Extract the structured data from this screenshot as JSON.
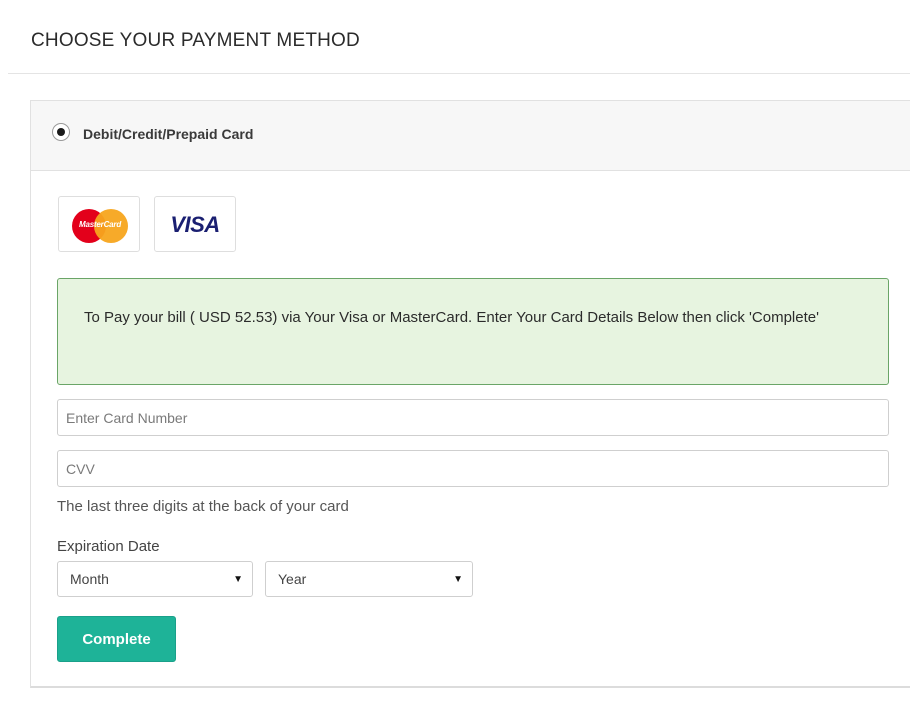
{
  "page": {
    "title": "CHOOSE YOUR PAYMENT METHOD"
  },
  "payment_option": {
    "label": "Debit/Credit/Prepaid Card",
    "selected": true
  },
  "card_brands": [
    {
      "name": "MasterCard",
      "logo_text": "MasterCard",
      "colors": [
        "#e3001b",
        "#f7a51e"
      ]
    },
    {
      "name": "Visa",
      "logo_text": "VISA",
      "color": "#1a1f71"
    }
  ],
  "notice": {
    "text": "To Pay your bill ( USD 52.53) via Your Visa or MasterCard. Enter Your Card Details Below then click 'Complete'"
  },
  "form": {
    "card_number_placeholder": "Enter Card Number",
    "cvv_placeholder": "CVV",
    "cvv_help": "The last three digits at the back of your card",
    "expiration_label": "Expiration Date",
    "month_value": "Month",
    "year_value": "Year",
    "submit_label": "Complete"
  },
  "colors": {
    "accent": "#1eb398",
    "notice_bg": "#e7f4e0",
    "notice_border": "#6aa567"
  }
}
